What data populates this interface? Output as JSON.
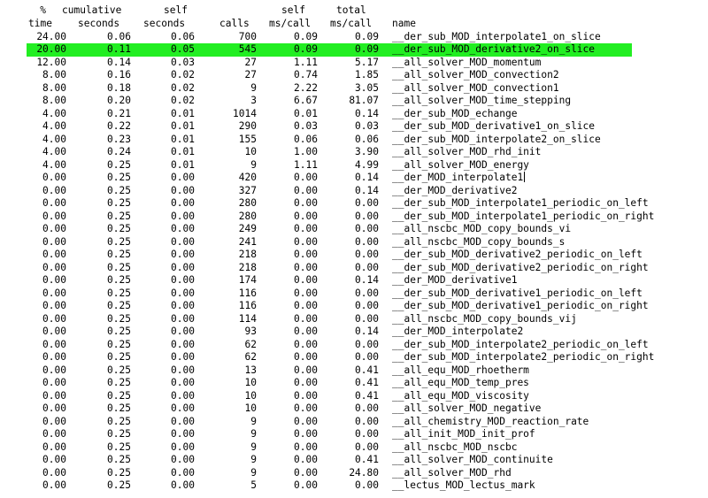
{
  "header": {
    "line1": {
      "pct": "%",
      "cumulative": "cumulative",
      "self": "self",
      "self_ms": "self",
      "total_ms": "total"
    },
    "line2": {
      "time": "time",
      "seconds1": "seconds",
      "seconds2": "seconds",
      "calls": "calls",
      "ms_call1": "ms/call",
      "ms_call2": "ms/call",
      "name": "name"
    }
  },
  "rows": [
    [
      "24.00",
      "0.06",
      "0.06",
      "700",
      "0.09",
      "0.09",
      "__der_sub_MOD_interpolate1_on_slice"
    ],
    [
      "20.00",
      "0.11",
      "0.05",
      "545",
      "0.09",
      "0.09",
      "__der_sub_MOD_derivative2_on_slice"
    ],
    [
      "12.00",
      "0.14",
      "0.03",
      "27",
      "1.11",
      "5.17",
      "__all_solver_MOD_momentum"
    ],
    [
      "8.00",
      "0.16",
      "0.02",
      "27",
      "0.74",
      "1.85",
      "__all_solver_MOD_convection2"
    ],
    [
      "8.00",
      "0.18",
      "0.02",
      "9",
      "2.22",
      "3.05",
      "__all_solver_MOD_convection1"
    ],
    [
      "8.00",
      "0.20",
      "0.02",
      "3",
      "6.67",
      "81.07",
      "__all_solver_MOD_time_stepping"
    ],
    [
      "4.00",
      "0.21",
      "0.01",
      "1014",
      "0.01",
      "0.14",
      "__der_sub_MOD_echange"
    ],
    [
      "4.00",
      "0.22",
      "0.01",
      "290",
      "0.03",
      "0.03",
      "__der_sub_MOD_derivative1_on_slice"
    ],
    [
      "4.00",
      "0.23",
      "0.01",
      "155",
      "0.06",
      "0.06",
      "__der_sub_MOD_interpolate2_on_slice"
    ],
    [
      "4.00",
      "0.24",
      "0.01",
      "10",
      "1.00",
      "3.90",
      "__all_solver_MOD_rhd_init"
    ],
    [
      "4.00",
      "0.25",
      "0.01",
      "9",
      "1.11",
      "4.99",
      "__all_solver_MOD_energy"
    ],
    [
      "0.00",
      "0.25",
      "0.00",
      "420",
      "0.00",
      "0.14",
      "__der_MOD_interpolate1"
    ],
    [
      "0.00",
      "0.25",
      "0.00",
      "327",
      "0.00",
      "0.14",
      "__der_MOD_derivative2"
    ],
    [
      "0.00",
      "0.25",
      "0.00",
      "280",
      "0.00",
      "0.00",
      "__der_sub_MOD_interpolate1_periodic_on_left"
    ],
    [
      "0.00",
      "0.25",
      "0.00",
      "280",
      "0.00",
      "0.00",
      "__der_sub_MOD_interpolate1_periodic_on_right"
    ],
    [
      "0.00",
      "0.25",
      "0.00",
      "249",
      "0.00",
      "0.00",
      "__all_nscbc_MOD_copy_bounds_vi"
    ],
    [
      "0.00",
      "0.25",
      "0.00",
      "241",
      "0.00",
      "0.00",
      "__all_nscbc_MOD_copy_bounds_s"
    ],
    [
      "0.00",
      "0.25",
      "0.00",
      "218",
      "0.00",
      "0.00",
      "__der_sub_MOD_derivative2_periodic_on_left"
    ],
    [
      "0.00",
      "0.25",
      "0.00",
      "218",
      "0.00",
      "0.00",
      "__der_sub_MOD_derivative2_periodic_on_right"
    ],
    [
      "0.00",
      "0.25",
      "0.00",
      "174",
      "0.00",
      "0.14",
      "__der_MOD_derivative1"
    ],
    [
      "0.00",
      "0.25",
      "0.00",
      "116",
      "0.00",
      "0.00",
      "__der_sub_MOD_derivative1_periodic_on_left"
    ],
    [
      "0.00",
      "0.25",
      "0.00",
      "116",
      "0.00",
      "0.00",
      "__der_sub_MOD_derivative1_periodic_on_right"
    ],
    [
      "0.00",
      "0.25",
      "0.00",
      "114",
      "0.00",
      "0.00",
      "__all_nscbc_MOD_copy_bounds_vij"
    ],
    [
      "0.00",
      "0.25",
      "0.00",
      "93",
      "0.00",
      "0.14",
      "__der_MOD_interpolate2"
    ],
    [
      "0.00",
      "0.25",
      "0.00",
      "62",
      "0.00",
      "0.00",
      "__der_sub_MOD_interpolate2_periodic_on_left"
    ],
    [
      "0.00",
      "0.25",
      "0.00",
      "62",
      "0.00",
      "0.00",
      "__der_sub_MOD_interpolate2_periodic_on_right"
    ],
    [
      "0.00",
      "0.25",
      "0.00",
      "13",
      "0.00",
      "0.41",
      "__all_equ_MOD_rhoetherm"
    ],
    [
      "0.00",
      "0.25",
      "0.00",
      "10",
      "0.00",
      "0.41",
      "__all_equ_MOD_temp_pres"
    ],
    [
      "0.00",
      "0.25",
      "0.00",
      "10",
      "0.00",
      "0.41",
      "__all_equ_MOD_viscosity"
    ],
    [
      "0.00",
      "0.25",
      "0.00",
      "10",
      "0.00",
      "0.00",
      "__all_solver_MOD_negative"
    ],
    [
      "0.00",
      "0.25",
      "0.00",
      "9",
      "0.00",
      "0.00",
      "__all_chemistry_MOD_reaction_rate"
    ],
    [
      "0.00",
      "0.25",
      "0.00",
      "9",
      "0.00",
      "0.00",
      "__all_init_MOD_init_prof"
    ],
    [
      "0.00",
      "0.25",
      "0.00",
      "9",
      "0.00",
      "0.00",
      "__all_nscbc_MOD_nscbc"
    ],
    [
      "0.00",
      "0.25",
      "0.00",
      "9",
      "0.00",
      "0.41",
      "__all_solver_MOD_continuite"
    ],
    [
      "0.00",
      "0.25",
      "0.00",
      "9",
      "0.00",
      "24.80",
      "__all_solver_MOD_rhd"
    ],
    [
      "0.00",
      "0.25",
      "0.00",
      "5",
      "0.00",
      "0.00",
      "__lectus_MOD_lectus_mark"
    ]
  ],
  "highlighted_row": 1,
  "highlight_color": "#22ee22",
  "cursor_row": 11
}
